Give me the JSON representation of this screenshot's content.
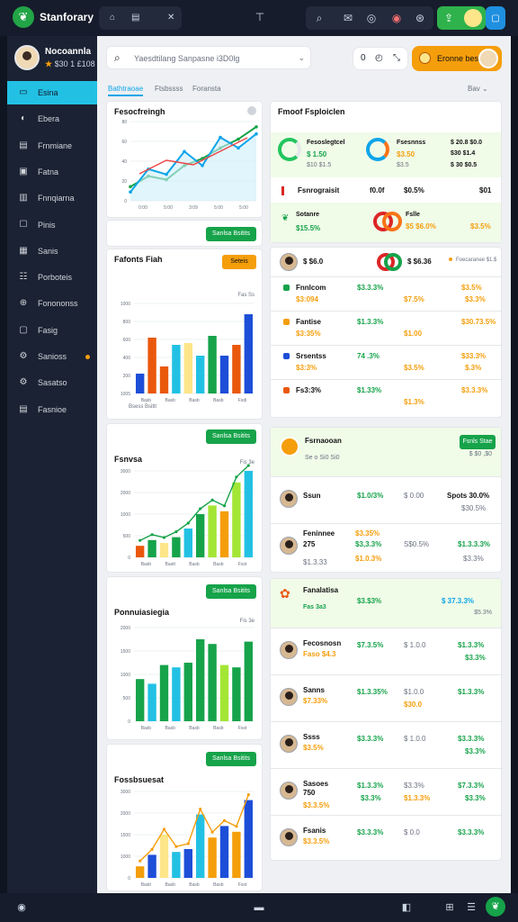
{
  "app": {
    "title": "Stanforary",
    "logo_icon": "leaf-icon"
  },
  "topbar": {
    "tab_label": "✕",
    "tab_icon_left": "⌂",
    "tab_icon_mid": "▤"
  },
  "profile": {
    "name": "Nocoannla",
    "stats": "$30 1 £108",
    "star": "★"
  },
  "nav": [
    {
      "label": "Esina",
      "icon": "▭",
      "active": true
    },
    {
      "label": "Ebera",
      "icon": "◐"
    },
    {
      "label": "Frnmiane",
      "icon": "▤"
    },
    {
      "label": "Fatna",
      "icon": "▣"
    },
    {
      "label": "Fnnqiarna",
      "icon": "▥"
    },
    {
      "label": "Pinis",
      "icon": "☐"
    },
    {
      "label": "Sanis",
      "icon": "▦"
    },
    {
      "label": "Porboteis",
      "icon": "☷"
    },
    {
      "label": "Fonononss",
      "icon": "⊕"
    },
    {
      "label": "Fasig",
      "icon": "▢"
    },
    {
      "label": "Sanioss",
      "icon": "⚙",
      "dot": true
    },
    {
      "label": "Sasatso",
      "icon": "⚙"
    },
    {
      "label": "Fasnioe",
      "icon": "▤"
    }
  ],
  "search": {
    "placeholder": "Yaesdtilang Sanpasne i3D0lg",
    "shortcut": "⌄"
  },
  "header_controls": {
    "c1": "0",
    "c2": "◴",
    "c3": "⤡",
    "cta_label": "Eronne bes"
  },
  "tabs": [
    "Bathtraoae",
    "Ftsbssss",
    "Foransta"
  ],
  "tabs_action": "Bav ⌄",
  "charts": {
    "c1": {
      "title": "Fesocfreingh",
      "xticks": [
        "0:00",
        "5:00",
        "3:09",
        "5:00",
        "5:00"
      ],
      "yticks": [
        "80",
        "60",
        "40",
        "20",
        "0"
      ]
    },
    "c2": {
      "title": "Fafonts Fiah",
      "btn": "Seteis",
      "xticks": [
        "Basb",
        "Basb",
        "Basb",
        "Basb",
        "Fsdi"
      ],
      "yticks": [
        "1000",
        "800",
        "600",
        "400",
        "200",
        "1005"
      ],
      "note": "Fas Ss",
      "foot": "Bsess Bsitlt"
    },
    "c3": {
      "title": "Fsnvsa",
      "btn": "Sanlsa Bsitits",
      "xticks": [
        "Basb",
        "Bastt",
        "Basb",
        "Basb",
        "Fsst"
      ],
      "yticks": [
        "3000",
        "2000",
        "1000",
        "500",
        "0"
      ],
      "note": "Fis 3e"
    },
    "c4": {
      "title": "Ponnuiasiegia",
      "btn": "Sanlsa Bsitits",
      "xticks": [
        "Basb",
        "Basb",
        "Basb",
        "Basb",
        "Fsst"
      ],
      "yticks": [
        "2000",
        "1500",
        "1000",
        "500",
        "0"
      ],
      "note": "Fis 3e"
    },
    "c5": {
      "title": "Fossbsuesat",
      "btn": "Sanlsa Bsitits",
      "xticks": [
        "Basb",
        "Basb",
        "Basb",
        "Basb",
        "Fsst"
      ],
      "yticks": [
        "3000",
        "2000",
        "1500",
        "1000",
        "0"
      ]
    },
    "c1_btn": "Sanlsa Bsitits"
  },
  "chart_data": [
    {
      "type": "line",
      "title": "Fesocfreingh",
      "x": [
        "0:00",
        "5:00",
        "3:09",
        "5:00",
        "5:00"
      ],
      "series": [
        {
          "values": [
            8,
            14,
            12,
            20,
            24,
            30,
            35,
            42
          ]
        },
        {
          "values": [
            5,
            18,
            15,
            28,
            20,
            36,
            30,
            38
          ]
        }
      ]
    },
    {
      "type": "bar",
      "title": "Fafonts Fiah",
      "categories": [
        "Basb",
        "Basb",
        "Basb",
        "Basb",
        "Fsdi"
      ],
      "values": [
        220,
        620,
        300,
        540,
        560,
        420,
        640,
        420,
        540,
        880
      ],
      "ylim": [
        0,
        1000
      ]
    },
    {
      "type": "bar",
      "title": "Fsnvsa",
      "categories": [
        "Basb",
        "Bastt",
        "Basb",
        "Basb",
        "Fsst"
      ],
      "values": [
        400,
        600,
        500,
        700,
        1000,
        1500,
        1800,
        1600,
        2600,
        3000
      ],
      "ylim": [
        0,
        3000
      ]
    },
    {
      "type": "bar",
      "title": "Ponnuiasiegia",
      "categories": [
        "Basb",
        "Basb",
        "Basb",
        "Basb",
        "Fsst"
      ],
      "values": [
        900,
        800,
        1200,
        1150,
        1250,
        1750,
        1650,
        1200,
        1150,
        1700
      ],
      "ylim": [
        0,
        2000
      ]
    },
    {
      "type": "bar",
      "title": "Fossbsuesat",
      "categories": [
        "Basb",
        "Basb",
        "Basb",
        "Basb",
        "Fsst"
      ],
      "values": [
        400,
        800,
        1500,
        900,
        1000,
        2200,
        1400,
        1800,
        1600,
        2700
      ],
      "ylim": [
        0,
        3000
      ]
    }
  ],
  "panel1": {
    "title": "Fmoof Fsploiclen",
    "m1_label": "Fesoslegtcel",
    "m1_value": "$ 1.50",
    "m1_sub": "$10 $1.5",
    "m2_label": "Fsesnnss",
    "m2_value": "$3.50",
    "m2_sub": "$3.5",
    "m3_label": "$ 20.8 $0.0",
    "m3_value": "$30 $1.4",
    "m3_sub": "$ 30 $0.5",
    "r2_label": "Fsnrograisit",
    "r2_a": "f0.0f",
    "r2_b": "$0.5%",
    "r2_c": "$01",
    "r3_label": "Sotanre",
    "r3_value": "$15.5%",
    "r3_right": "$3.5%",
    "r3_mid_label": "Fslle",
    "r3_mid": "$5 $6.0%"
  },
  "panel2": {
    "head": "$ $6.0",
    "head_mid": "$ $6.36",
    "head_right": "Foecaranee $1.$",
    "rows": [
      {
        "label": "Fnnlcom",
        "value": "$3:094",
        "mid": "$3.3.3%",
        "mid2": "$7.5%",
        "right": "$3.5%",
        "right2": "$3.3%",
        "color": "#16a34a"
      },
      {
        "label": "Fantise",
        "value": "$3:35%",
        "mid": "$1.3.3%",
        "mid2": "$1.00",
        "right": "$30.73.5%",
        "right2": "",
        "color": "#f59e0b"
      },
      {
        "label": "Srsentss",
        "value": "$3:3%",
        "mid": "74 .3%",
        "mid2": "$3.5%",
        "right": "$33.3%",
        "right2": "$.3%",
        "color": "#1d4ed8"
      },
      {
        "label": "Fs3:3%",
        "value": "",
        "mid": "$1.33%",
        "mid2": "$1.3%",
        "right": "$3.3.3%",
        "right2": "",
        "color": "#ea580c"
      }
    ]
  },
  "panel3": {
    "title": "Fsrnaooan",
    "sub": "Se o  Si0  Si0",
    "btn": "Fsnls Stae",
    "right_sub": "$ $0 ,$0",
    "rows": [
      {
        "name": "Ssun",
        "a": "$1.0/3%",
        "b": "$ 0.00",
        "c": "Spots 30.0%",
        "d": "$30.5%"
      },
      {
        "name": "Feninnee",
        "big": "275",
        "pre": "$3.35%",
        "a": "$3,3.3%",
        "b": "$1.0.3%",
        "sub": "$1.3.33",
        "c": "$1.3.3.3%",
        "d": "$3.3%",
        "sub2": "S$0.5%"
      }
    ]
  },
  "panel4": {
    "title": "Fanalatisa",
    "title_a": "$3.$3%",
    "title_b": "$ 37.3.3%",
    "title_sub": "Fas 3a3",
    "right_sub": "$5.3%",
    "rows": [
      {
        "name": "Fecosnosn",
        "sub": "Faso $4.3",
        "a": "$7.3.5%",
        "b": "$ 1.0.0",
        "c": "$1.3.3%",
        "d": "$3.3%"
      },
      {
        "name": "Sanns",
        "sub": "$7.33%",
        "a": "$1.3.35%",
        "b": "$1.0.0",
        "b2": "$30.0",
        "c": "$1.3.3%"
      },
      {
        "name": "Ssss",
        "sub": "$3.5%",
        "a": "$3.3.3%",
        "b": "$ 1.0.0",
        "c": "$3.3.3%",
        "d": "$3.3%"
      },
      {
        "name": "Sasoes",
        "big": "750",
        "sub": "$3.3.5%",
        "a": "$1.3.3%",
        "a2": "$3.3%",
        "b": "$3.3%",
        "b2": "$1.3.3%",
        "c": "$7.3.3%",
        "d": "$3.3%"
      },
      {
        "name": "Fsanis",
        "sub": "$3.3.5%",
        "a": "$3.3.3%",
        "b": "$ 0.0",
        "c": "$3.3.3%"
      }
    ]
  },
  "bottombar": {
    "left": "◉",
    "mid": "▬",
    "r1": "◧",
    "r2": "⊞",
    "r3": "☰"
  },
  "colors": {
    "accent": "#22c1e4",
    "green": "#16a34a",
    "orange": "#f59e0b",
    "blue": "#1d4ed8"
  }
}
